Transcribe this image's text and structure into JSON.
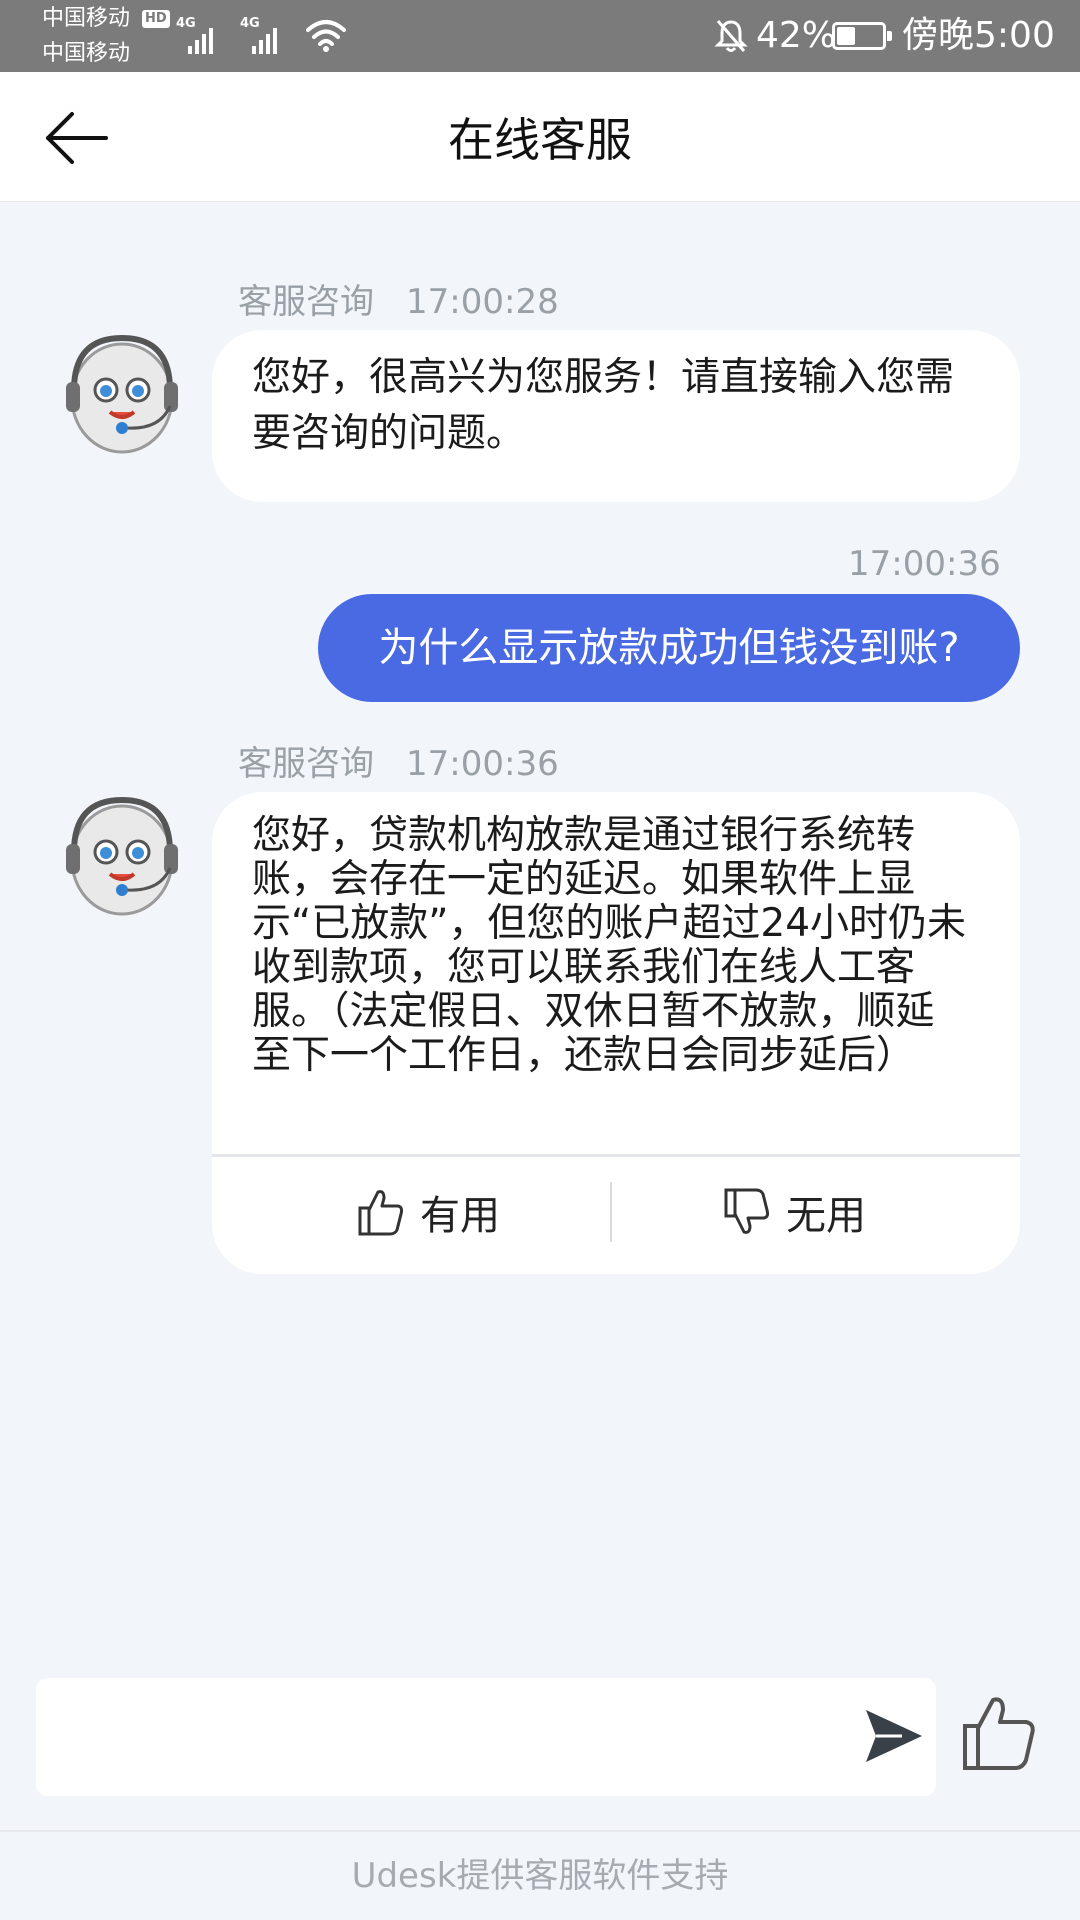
{
  "status_bar": {
    "carrier_1": "中国移动",
    "carrier_2": "中国移动",
    "hd": "HD",
    "network_1": "4G",
    "network_2": "4G",
    "battery_percent": "42%",
    "battery_level": 0.42,
    "time": "傍晚5:00"
  },
  "header": {
    "title": "在线客服"
  },
  "messages": [
    {
      "sender": "客服咨询",
      "time": "17:00:28",
      "text": "您好，很高兴为您服务！请直接输入您需要咨询的问题。"
    },
    {
      "time": "17:00:36",
      "text": "为什么显示放款成功但钱没到账?"
    },
    {
      "sender": "客服咨询",
      "time": "17:00:36",
      "text": "您好，贷款机构放款是通过银行系统转账，会存在一定的延迟。如果软件上显示“已放款”，但您的账户超过24小时仍未收到款项，您可以联系我们在线人工客服。（法定假日、双休日暂不放款，顺延至下一个工作日，还款日会同步延后）"
    }
  ],
  "feedback": {
    "useful_label": "有用",
    "useless_label": "无用"
  },
  "footer": {
    "text": "Udesk提供客服软件支持"
  },
  "colors": {
    "accent": "#4a6ae3",
    "background": "#f2f5f9",
    "status_bar": "#7b7b7b"
  },
  "icons": [
    "back-arrow-icon",
    "agent-avatar-icon",
    "thumbs-up-icon",
    "thumbs-down-icon",
    "send-icon",
    "like-icon",
    "wifi-icon",
    "bell-off-icon",
    "battery-icon"
  ]
}
